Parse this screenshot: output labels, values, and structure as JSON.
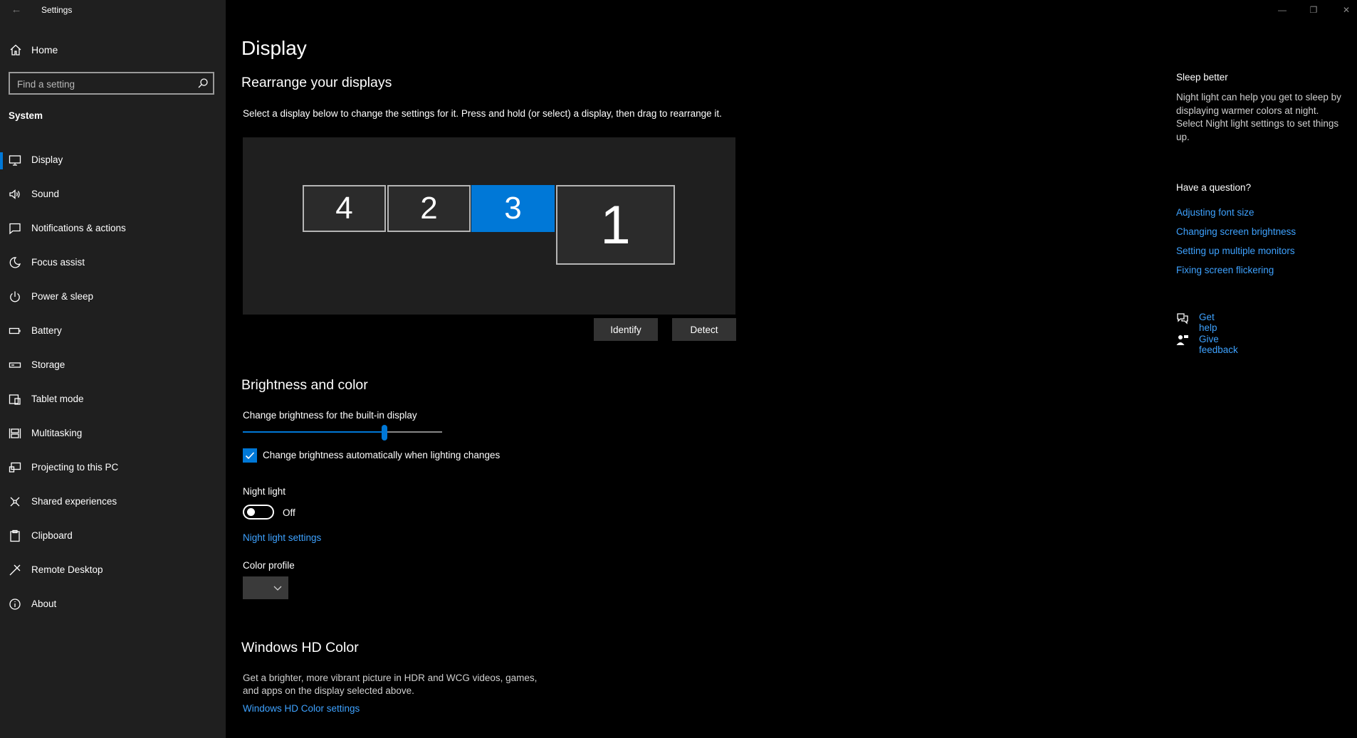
{
  "app": {
    "title": "Settings",
    "back_icon": "back-arrow-icon"
  },
  "sidebar": {
    "home_label": "Home",
    "search_placeholder": "Find a setting",
    "section": "System",
    "items": [
      {
        "label": "Display",
        "icon": "monitor-icon",
        "active": true
      },
      {
        "label": "Sound",
        "icon": "speaker-icon"
      },
      {
        "label": "Notifications & actions",
        "icon": "notification-icon"
      },
      {
        "label": "Focus assist",
        "icon": "moon-icon"
      },
      {
        "label": "Power & sleep",
        "icon": "power-icon"
      },
      {
        "label": "Battery",
        "icon": "battery-icon"
      },
      {
        "label": "Storage",
        "icon": "storage-icon"
      },
      {
        "label": "Tablet mode",
        "icon": "tablet-icon"
      },
      {
        "label": "Multitasking",
        "icon": "multitasking-icon"
      },
      {
        "label": "Projecting to this PC",
        "icon": "projecting-icon"
      },
      {
        "label": "Shared experiences",
        "icon": "shared-icon"
      },
      {
        "label": "Clipboard",
        "icon": "clipboard-icon"
      },
      {
        "label": "Remote Desktop",
        "icon": "remote-desktop-icon"
      },
      {
        "label": "About",
        "icon": "info-icon"
      }
    ]
  },
  "main": {
    "title": "Display",
    "rearrange": {
      "heading": "Rearrange your displays",
      "description": "Select a display below to change the settings for it. Press and hold (or select) a display, then drag to rearrange it.",
      "monitors": [
        {
          "label": "4",
          "selected": false
        },
        {
          "label": "2",
          "selected": false
        },
        {
          "label": "3",
          "selected": true
        },
        {
          "label": "1",
          "selected": false
        }
      ],
      "identify_label": "Identify",
      "detect_label": "Detect"
    },
    "brightness": {
      "heading": "Brightness and color",
      "slider_label": "Change brightness for the built-in display",
      "slider_value_percent": 71,
      "auto_label": "Change brightness automatically when lighting changes",
      "auto_checked": true,
      "night_light_label": "Night light",
      "night_light_state": "Off",
      "night_light_settings": "Night light settings",
      "color_profile_label": "Color profile"
    },
    "hdr": {
      "heading": "Windows HD Color",
      "description_line1": "Get a brighter, more vibrant picture in HDR and WCG videos, games,",
      "description_line2": "and apps on the display selected above.",
      "settings_link": "Windows HD Color settings"
    }
  },
  "right": {
    "sleep_heading": "Sleep better",
    "sleep_text": "Night light can help you get to sleep by displaying warmer colors at night. Select Night light settings to set things up.",
    "question_heading": "Have a question?",
    "links": [
      "Adjusting font size",
      "Changing screen brightness",
      "Setting up multiple monitors",
      "Fixing screen flickering"
    ],
    "get_help": "Get help",
    "give_feedback": "Give feedback"
  },
  "colors": {
    "accent": "#0078d7",
    "link": "#3ea2ff",
    "sidebar_bg": "#1f1f1f",
    "main_bg": "#000000"
  }
}
